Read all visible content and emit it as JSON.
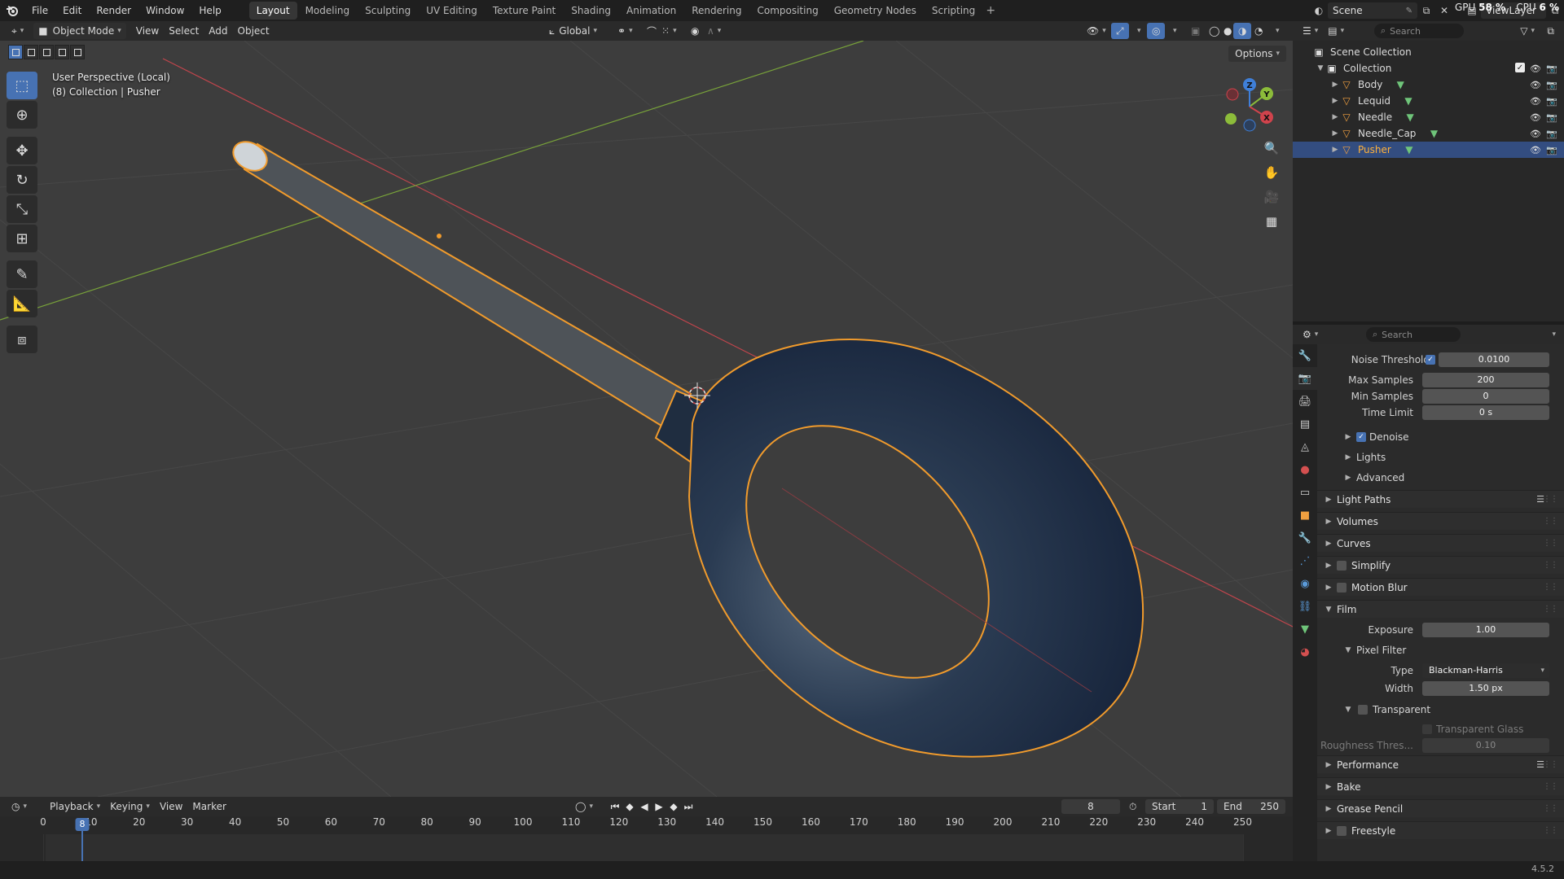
{
  "topbar": {
    "menus": [
      "File",
      "Edit",
      "Render",
      "Window",
      "Help"
    ],
    "workspaces": [
      "Layout",
      "Modeling",
      "Sculpting",
      "UV Editing",
      "Texture Paint",
      "Shading",
      "Animation",
      "Rendering",
      "Compositing",
      "Geometry Nodes",
      "Scripting"
    ],
    "active_workspace": "Layout",
    "add_workspace": "+",
    "scene": "Scene",
    "view_layer": "ViewLayer",
    "gpu_label": "GPU",
    "gpu_value": "58 %",
    "cpu_label": "CPU",
    "cpu_value": "6 %"
  },
  "viewport": {
    "mode": "Object Mode",
    "menus": [
      "View",
      "Select",
      "Add",
      "Object"
    ],
    "transform_orientation": "Global",
    "info_line1": "User Perspective (Local)",
    "info_line2": "(8) Collection | Pusher",
    "options_label": "Options",
    "gizmo_axes": {
      "x": "X",
      "y": "Y",
      "z": "Z"
    },
    "colors": {
      "background": "#3d3d3d",
      "selection_outline": "#f19b2c",
      "axis_x": "#d0434c",
      "axis_y": "#8cbc3a",
      "axis_z": "#3f7fd8",
      "ring_body": "#22344a"
    }
  },
  "outliner": {
    "search_placeholder": "Search",
    "root": "Scene Collection",
    "collection": "Collection",
    "objects": [
      "Body",
      "Lequid",
      "Needle",
      "Needle_Cap",
      "Pusher"
    ],
    "selected": "Pusher"
  },
  "properties": {
    "search_placeholder": "Search",
    "noise_threshold_label": "Noise Threshold",
    "noise_threshold_value": "0.0100",
    "max_samples_label": "Max Samples",
    "max_samples_value": "200",
    "min_samples_label": "Min Samples",
    "min_samples_value": "0",
    "time_limit_label": "Time Limit",
    "time_limit_value": "0 s",
    "denoise_label": "Denoise",
    "lights_label": "Lights",
    "advanced_label": "Advanced",
    "panels": {
      "light_paths": "Light Paths",
      "volumes": "Volumes",
      "curves": "Curves",
      "simplify": "Simplify",
      "motion_blur": "Motion Blur",
      "film": "Film",
      "performance": "Performance",
      "bake": "Bake",
      "grease_pencil": "Grease Pencil",
      "freestyle": "Freestyle"
    },
    "exposure_label": "Exposure",
    "exposure_value": "1.00",
    "pixel_filter_label": "Pixel Filter",
    "type_label": "Type",
    "type_value": "Blackman-Harris",
    "width_label": "Width",
    "width_value": "1.50 px",
    "transparent_label": "Transparent",
    "transparent_glass_label": "Transparent Glass",
    "roughness_label": "Roughness Thres...",
    "roughness_value": "0.10"
  },
  "timeline": {
    "menus": [
      "Playback",
      "Keying",
      "View",
      "Marker"
    ],
    "current_frame": "8",
    "start_label": "Start",
    "start_value": "1",
    "end_label": "End",
    "end_value": "250",
    "ticks": [
      "0",
      "10",
      "20",
      "30",
      "40",
      "50",
      "60",
      "70",
      "80",
      "90",
      "100",
      "110",
      "120",
      "130",
      "140",
      "150",
      "160",
      "170",
      "180",
      "190",
      "200",
      "210",
      "220",
      "230",
      "240",
      "250"
    ]
  },
  "statusbar": {
    "version": "4.5.2"
  }
}
